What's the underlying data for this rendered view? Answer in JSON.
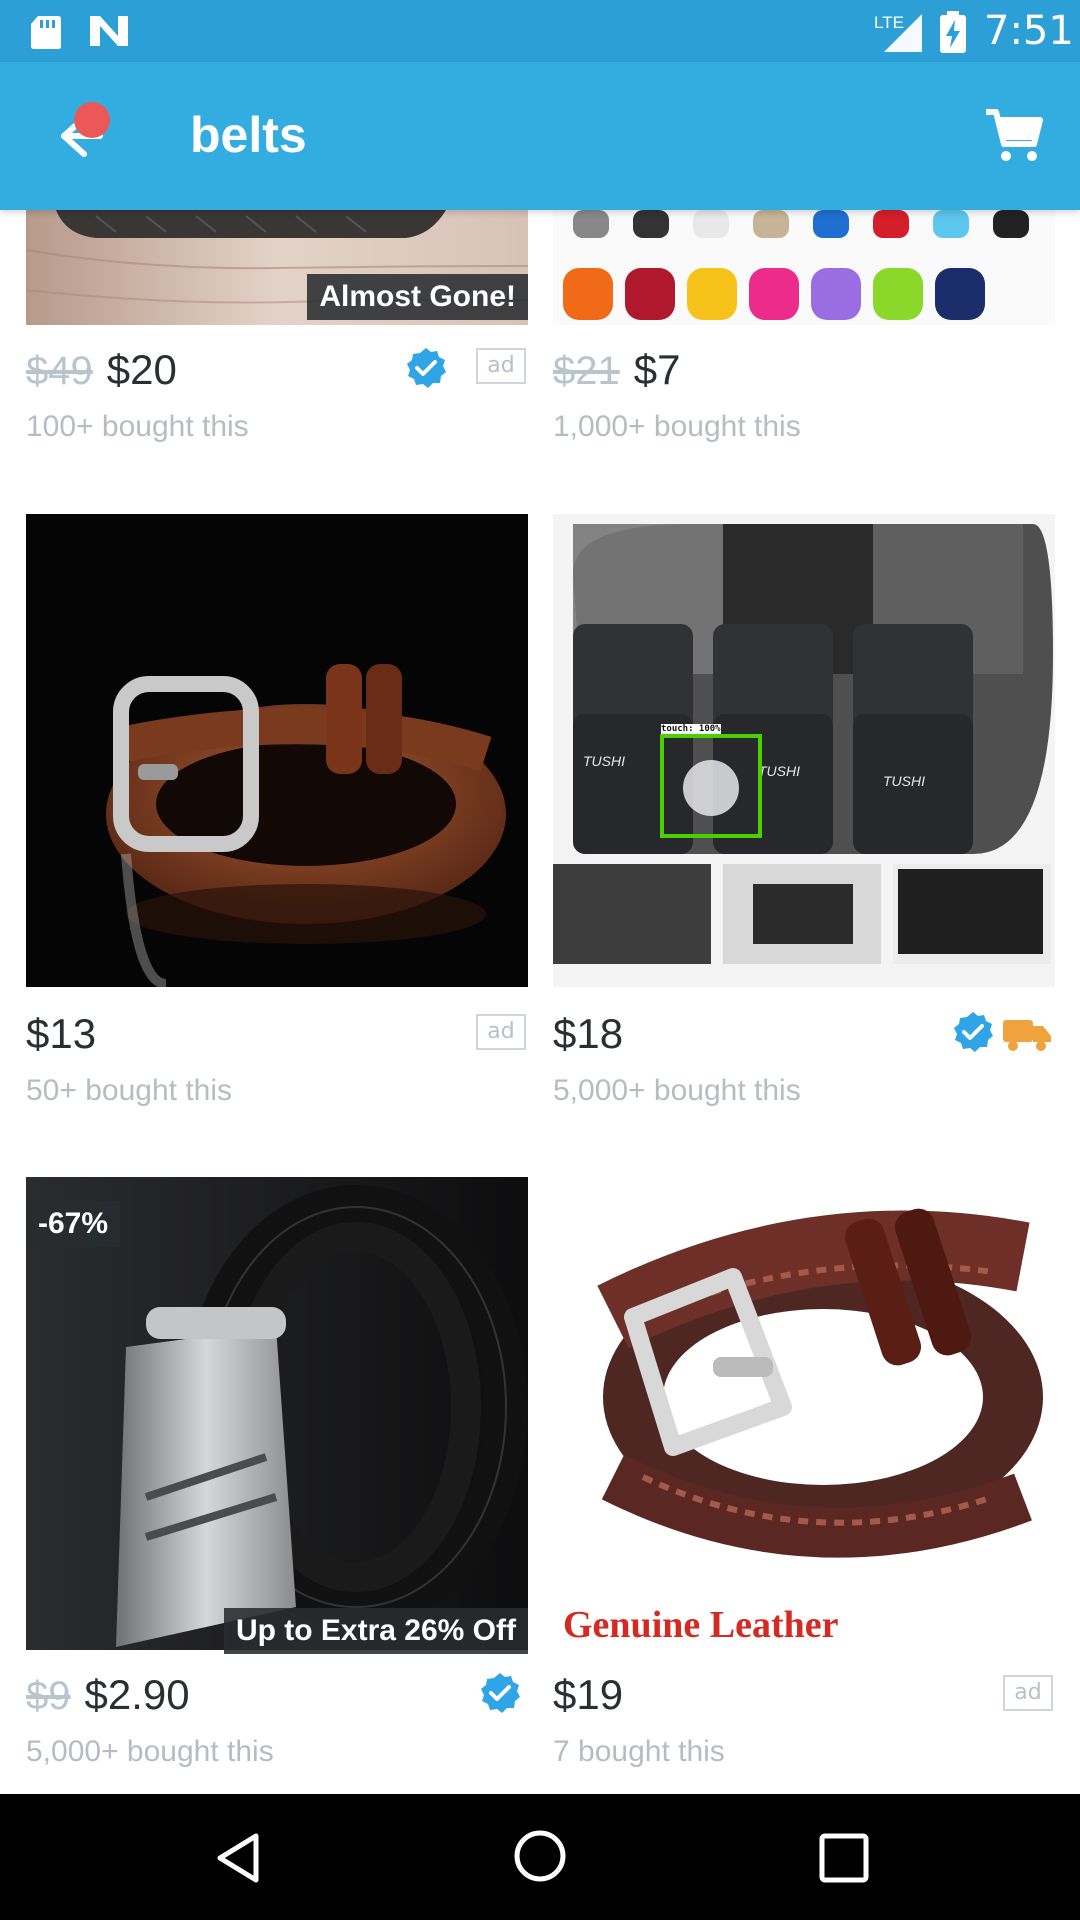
{
  "status_bar": {
    "time": "7:51",
    "network": "LTE"
  },
  "app_bar": {
    "title": "belts"
  },
  "products": [
    {
      "old_price": "$49",
      "price": "$20",
      "bought": "100+ bought this",
      "tag": "Almost Gone!",
      "verified": true,
      "ad": "ad"
    },
    {
      "old_price": "$21",
      "price": "$7",
      "bought": "1,000+ bought this"
    },
    {
      "price": "$13",
      "bought": "50+ bought this",
      "ad": "ad"
    },
    {
      "price": "$18",
      "bought": "5,000+ bought this",
      "verified": true,
      "fast_shipping": true,
      "brand_text": "TUSHI"
    },
    {
      "old_price": "$9",
      "price": "$2.90",
      "bought": "5,000+ bought this",
      "discount": "-67%",
      "tag": "Up to Extra 26% Off",
      "verified": true
    },
    {
      "price": "$19",
      "bought": "7 bought this",
      "ad": "ad",
      "image_caption": "Genuine Leather"
    }
  ],
  "touch_indicator": {
    "label": "touch: 100%"
  },
  "colors": {
    "status_bar": "#2b9fd6",
    "app_bar": "#33ade0",
    "verified": "#2fa4e7",
    "shipping": "#f0a23c"
  }
}
